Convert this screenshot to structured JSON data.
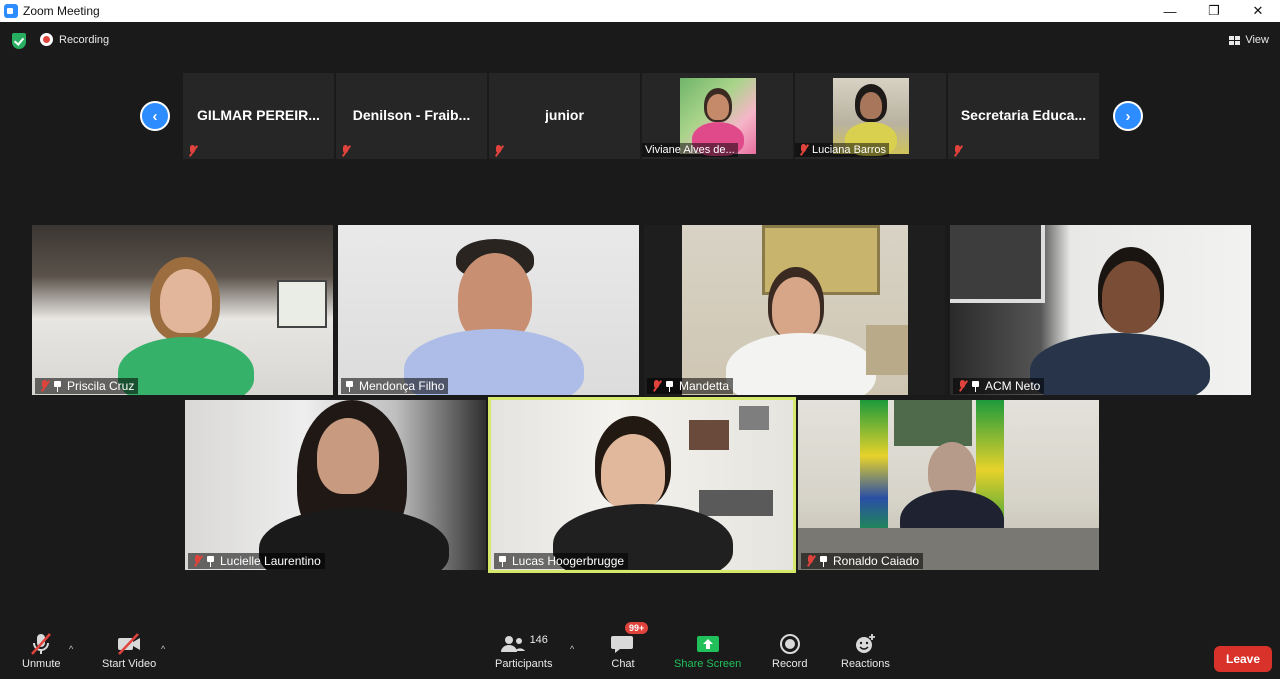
{
  "window": {
    "title": "Zoom Meeting",
    "minimize": "—",
    "restore": "❐",
    "close": "✕"
  },
  "topbar": {
    "recording_label": "Recording",
    "view_label": "View"
  },
  "strip": {
    "prev_arrow": "‹",
    "next_arrow": "›",
    "participants": [
      {
        "name": "GILMAR PEREIR...",
        "video": false
      },
      {
        "name": "Denilson  - Fraib...",
        "video": false
      },
      {
        "name": "junior",
        "video": false
      },
      {
        "name": "Viviane Alves de...",
        "video": true
      },
      {
        "name": "Luciana Barros",
        "video": true
      },
      {
        "name": "Secretaria  Educa...",
        "video": false
      }
    ]
  },
  "gallery": {
    "tiles": [
      {
        "name": "Priscila Cruz",
        "muted": true,
        "pinned": true
      },
      {
        "name": "Mendonça Filho",
        "muted": false,
        "pinned": true
      },
      {
        "name": "Mandetta",
        "muted": true,
        "pinned": true
      },
      {
        "name": "ACM Neto",
        "muted": true,
        "pinned": true
      },
      {
        "name": "Lucielle Laurentino",
        "muted": true,
        "pinned": true
      },
      {
        "name": "Lucas Hoogerbrugge",
        "muted": false,
        "pinned": true,
        "active_speaker": true
      },
      {
        "name": "Ronaldo Caiado",
        "muted": true,
        "pinned": true
      }
    ]
  },
  "toolbar": {
    "unmute_label": "Unmute",
    "start_video_label": "Start Video",
    "participants_label": "Participants",
    "participants_count": "146",
    "chat_label": "Chat",
    "chat_badge": "99+",
    "share_label": "Share Screen",
    "record_label": "Record",
    "reactions_label": "Reactions",
    "leave_label": "Leave",
    "caret": "^"
  },
  "colors": {
    "accent": "#2d8cff",
    "share_green": "#21c05a",
    "leave_red": "#d8322a",
    "speaker_border": "#d6e86a"
  }
}
